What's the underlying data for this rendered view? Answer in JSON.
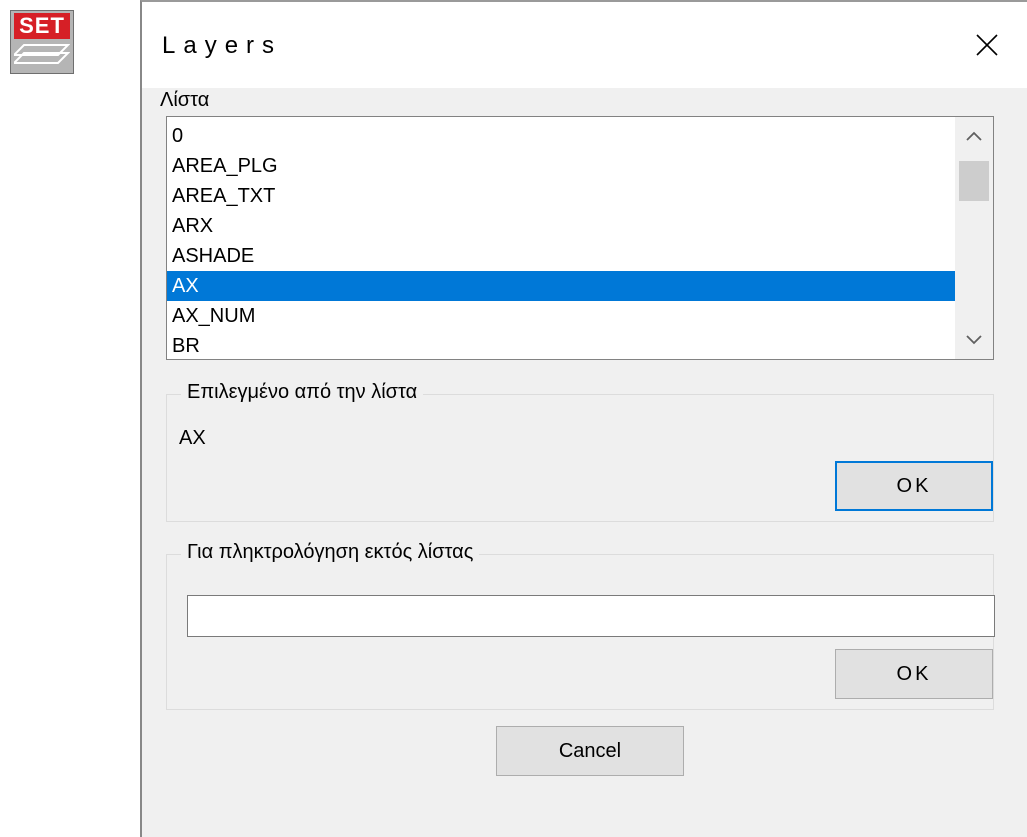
{
  "app_icon": {
    "label": "SET"
  },
  "dialog": {
    "title": "Layers",
    "list_label": "Λίστα",
    "list_items": [
      "0",
      "AREA_PLG",
      "AREA_TXT",
      "ARX",
      "ASHADE",
      "AX",
      "AX_NUM",
      "BR"
    ],
    "selected_index": 5,
    "selected_group": {
      "legend": "Επιλεγμένο από την λίστα",
      "value": "AX",
      "ok_label": "OK"
    },
    "manual_group": {
      "legend": "Για πληκτρολόγηση εκτός λίστας",
      "input_value": "",
      "ok_label": "OK"
    },
    "cancel_label": "Cancel",
    "colors": {
      "selection": "#0078d7",
      "set_icon_red": "#d61f26"
    }
  }
}
